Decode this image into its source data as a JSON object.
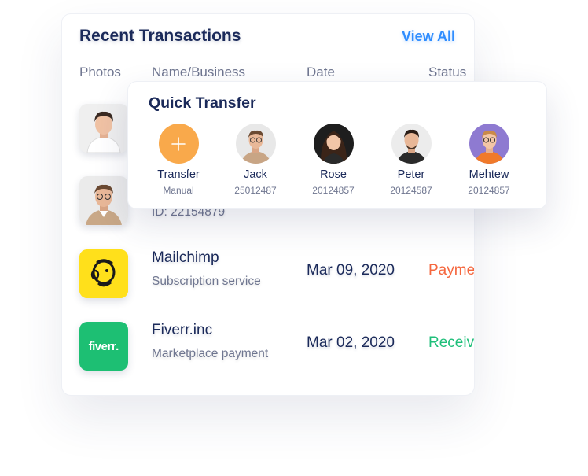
{
  "transactions": {
    "title": "Recent Transactions",
    "view_all": "View All",
    "columns": {
      "photos": "Photos",
      "name": "Name/Business",
      "date": "Date",
      "status": "Status"
    },
    "rows": [
      {
        "name": "",
        "sub": "",
        "date": "",
        "status": ""
      },
      {
        "name": "",
        "sub": "ID: 22154879",
        "date": "",
        "status": ""
      },
      {
        "name": "Mailchimp",
        "sub": "Subscription service",
        "date": "Mar 09, 2020",
        "status": "Payme",
        "status_color": "#f5673e"
      },
      {
        "name": "Fiverr.inc",
        "sub": "Marketplace payment",
        "date": "Mar 02, 2020",
        "status": "Receiv",
        "status_color": "#1fbf7a"
      }
    ],
    "logos": {
      "fiverr": "fiverr",
      "fiverr_dot": "."
    }
  },
  "quick_transfer": {
    "title": "Quick Transfer",
    "add": {
      "name": "Transfer",
      "sub": "Manual",
      "icon": "plus-icon",
      "color": "#f9a94b"
    },
    "contacts": [
      {
        "name": "Jack",
        "id": "25012487"
      },
      {
        "name": "Rose",
        "id": "20124857"
      },
      {
        "name": "Peter",
        "id": "20124587"
      },
      {
        "name": "Mehtew",
        "id": "20124857"
      }
    ]
  },
  "colors": {
    "accent": "#2f8dff",
    "navy": "#1b2a5a",
    "mailchimp": "#ffe01b",
    "fiverr": "#1dbf73"
  }
}
